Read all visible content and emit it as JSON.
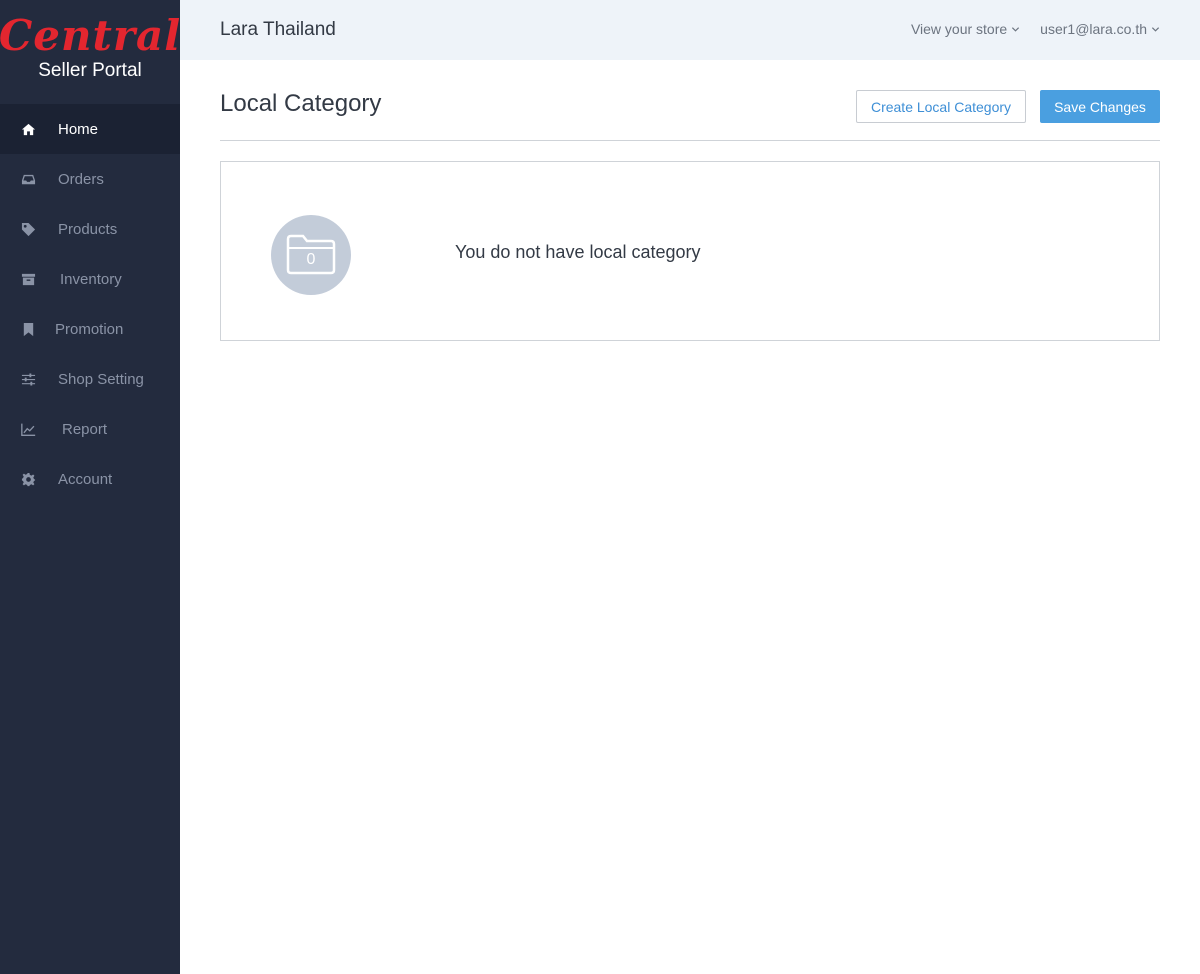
{
  "brand": {
    "logo_script": "Central",
    "logo_sub": "Seller Portal",
    "accent": "#e3262f"
  },
  "sidebar": {
    "items": [
      {
        "label": "Home",
        "icon": "home-icon",
        "active": true
      },
      {
        "label": "Orders",
        "icon": "inbox-icon"
      },
      {
        "label": "Products",
        "icon": "tag-icon"
      },
      {
        "label": "Inventory",
        "icon": "archive-icon"
      },
      {
        "label": "Promotion",
        "icon": "bookmark-icon"
      },
      {
        "label": "Shop Setting",
        "icon": "sliders-icon"
      },
      {
        "label": "Report",
        "icon": "line-chart-icon"
      },
      {
        "label": "Account",
        "icon": "gear-icon"
      }
    ]
  },
  "header": {
    "store_name": "Lara Thailand",
    "view_store": "View your store",
    "user": "user1@lara.co.th"
  },
  "main": {
    "title": "Local Category",
    "create_button": "Create Local Category",
    "save_button": "Save Changes",
    "empty": {
      "count": "0",
      "message": "You do not have local category",
      "icon": "folder-icon"
    }
  },
  "colors": {
    "sidebar_bg": "#232b3e",
    "primary": "#4a9fe0",
    "topbar_bg": "#eef3f9"
  }
}
